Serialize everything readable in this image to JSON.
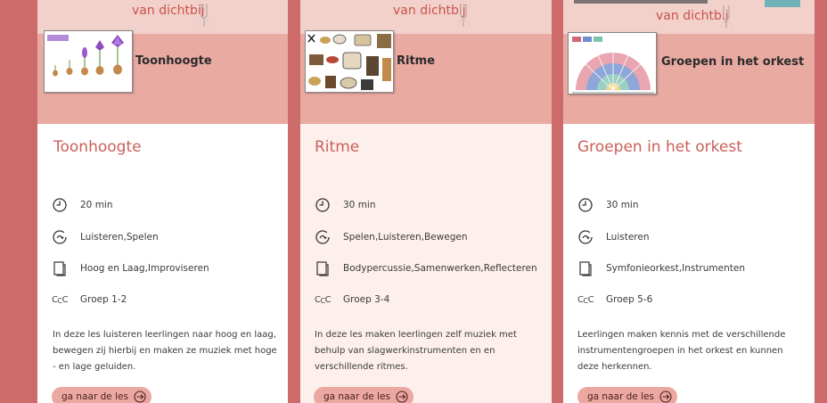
{
  "brand_text": "van dichtbij",
  "card_template": {
    "cta_label": "ga naar de les",
    "icons": [
      "clock-icon",
      "cycle-icon",
      "document-icon",
      "ccc-icon"
    ]
  },
  "colors": {
    "accent": "#cd6b6b",
    "banner": "#e9aaa2",
    "title": "#cb5f58",
    "button": "#eba8a0"
  },
  "cards": [
    {
      "banner_title": "Toonhoogte",
      "title": "Toonhoogte",
      "duration": "20 min",
      "activities": "Luisteren,Spelen",
      "topics": "Hoog en Laag,Improviseren",
      "group": "Groep 1-2",
      "description": "In deze les luisteren leerlingen naar hoog en laag, bewegen zij hierbij en maken ze muziek met hoge - en lage geluiden.",
      "cta": "ga naar de les"
    },
    {
      "banner_title": "Ritme",
      "title": "Ritme",
      "duration": "30 min",
      "activities": "Spelen,Luisteren,Bewegen",
      "topics": "Bodypercussie,Samenwerken,Reflecteren",
      "group": "Groep 3-4",
      "description": "In deze les maken leerlingen zelf muziek met behulp van slagwerkinstrumenten en en verschillende ritmes.",
      "cta": "ga naar de les"
    },
    {
      "banner_title": "Groepen in het orkest",
      "title": "Groepen in het orkest",
      "duration": "30 min",
      "activities": "Luisteren",
      "topics": "Symfonieorkest,Instrumenten",
      "group": "Groep 5-6",
      "description": "Leerlingen maken kennis met de verschillende instrumentengroepen in het orkest en kunnen deze herkennen.",
      "cta": "ga naar de les"
    }
  ]
}
